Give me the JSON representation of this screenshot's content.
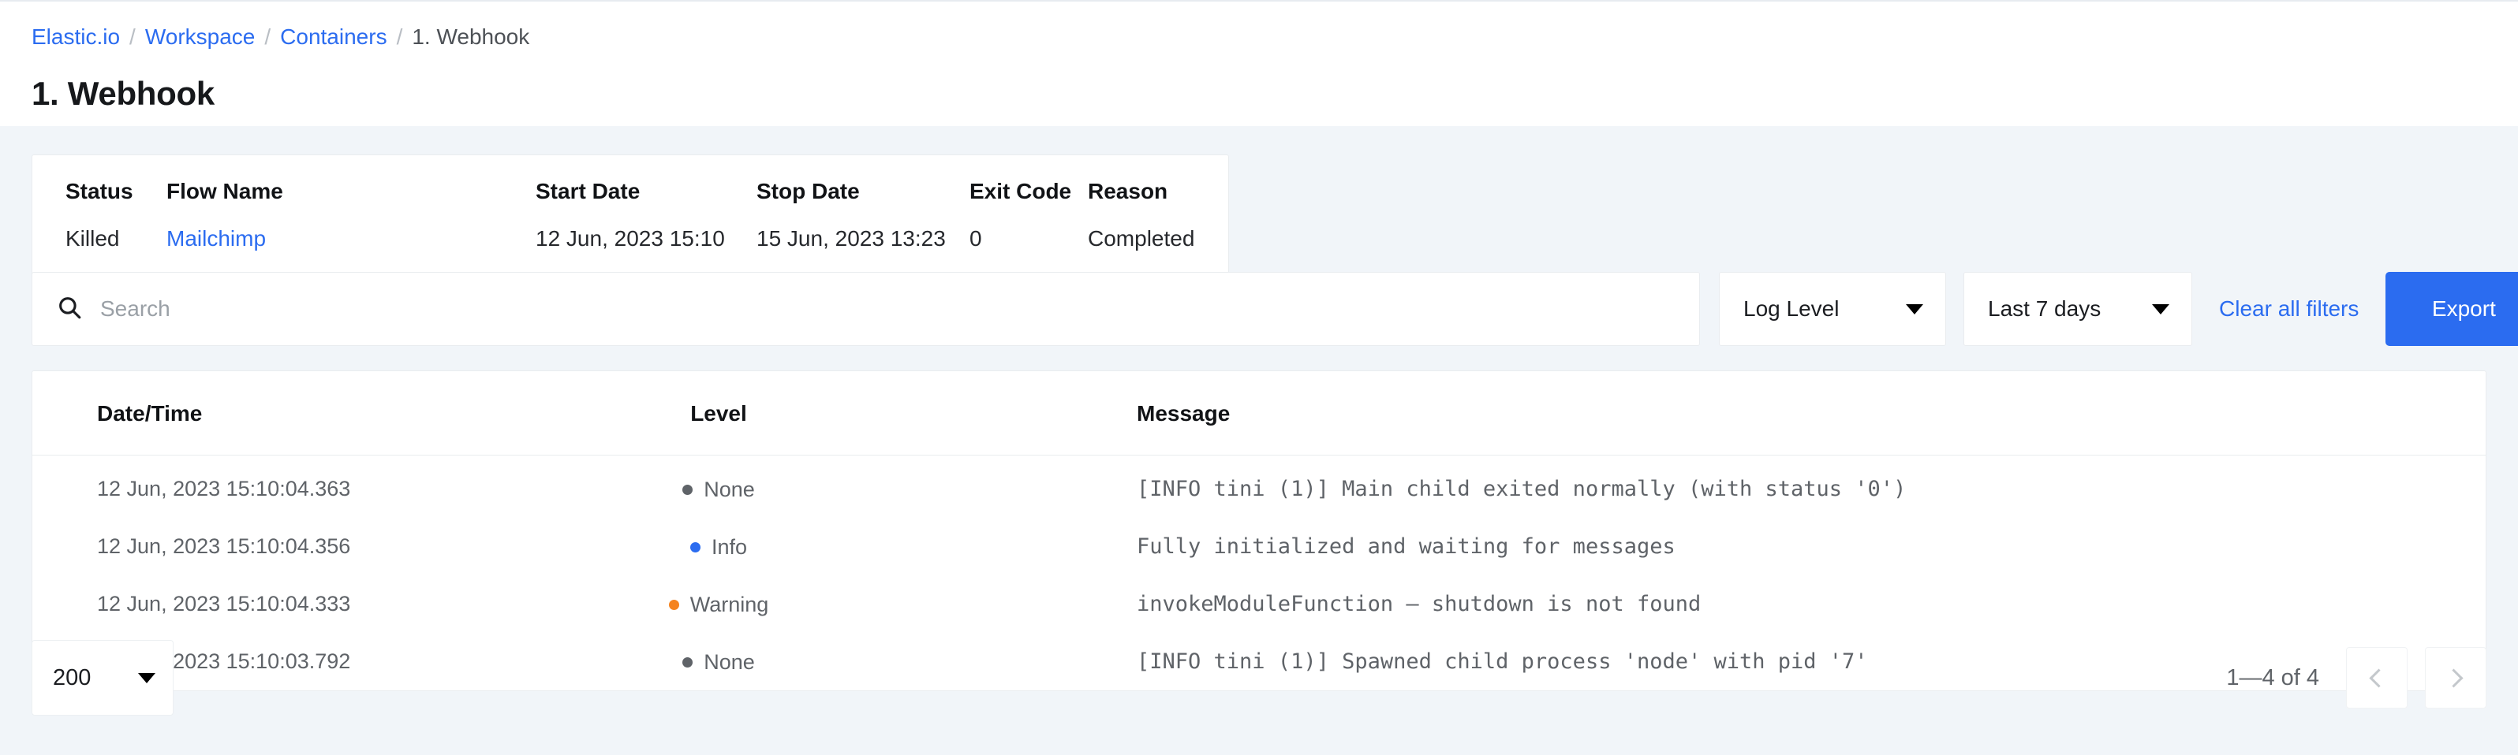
{
  "breadcrumb": {
    "items": [
      {
        "label": "Elastic.io",
        "link": true
      },
      {
        "label": "Workspace",
        "link": true
      },
      {
        "label": "Containers",
        "link": true
      },
      {
        "label": "1. Webhook",
        "link": false
      }
    ],
    "separator": "/"
  },
  "page": {
    "title": "1. Webhook"
  },
  "info_table": {
    "headers": [
      "Status",
      "Flow Name",
      "Start Date",
      "Stop Date",
      "Exit Code",
      "Reason"
    ],
    "row": {
      "status": "Killed",
      "flow_name": "Mailchimp",
      "start_date": "12 Jun, 2023 15:10",
      "stop_date": "15 Jun, 2023 13:23",
      "exit_code": "0",
      "reason": "Completed"
    }
  },
  "filters": {
    "search_placeholder": "Search",
    "search_value": "",
    "search_icon": "search-icon",
    "log_level_label": "Log Level",
    "date_range_label": "Last 7 days",
    "clear_all_label": "Clear all filters",
    "export_label": "Export",
    "export_color": "#2b6cf0",
    "link_color": "#2b6cf0"
  },
  "log_table": {
    "headers": [
      "Date/Time",
      "Level",
      "Message"
    ],
    "rows": [
      {
        "datetime": "12 Jun, 2023 15:10:04.363",
        "level": "None",
        "level_color": "#5f6368",
        "message": "[INFO tini (1)] Main child exited normally (with status '0')"
      },
      {
        "datetime": "12 Jun, 2023 15:10:04.356",
        "level": "Info",
        "level_color": "#2b6cf0",
        "message": "Fully initialized and waiting for messages"
      },
      {
        "datetime": "12 Jun, 2023 15:10:04.333",
        "level": "Warning",
        "level_color": "#f5831f",
        "message": "invokeModuleFunction — shutdown is not found"
      },
      {
        "datetime": "12 Jun, 2023 15:10:03.792",
        "level": "None",
        "level_color": "#5f6368",
        "message": "[INFO tini (1)] Spawned child process 'node' with pid '7'"
      }
    ]
  },
  "pagination": {
    "page_size": "200",
    "range_label": "1—4 of 4",
    "prev_icon": "chevron-left-icon",
    "next_icon": "chevron-right-icon"
  }
}
